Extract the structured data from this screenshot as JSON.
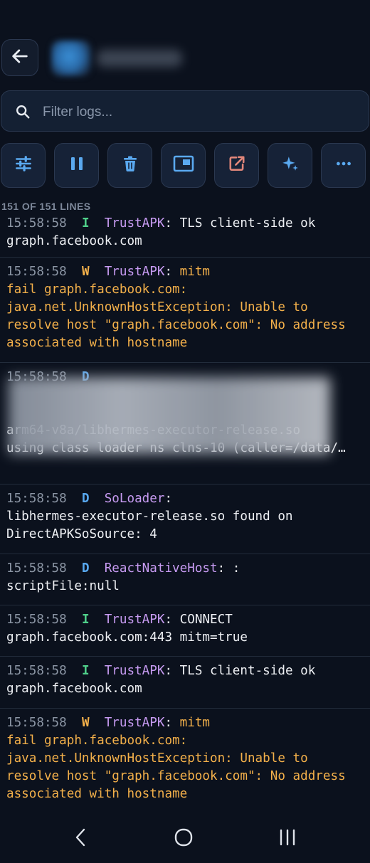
{
  "header": {
    "back_icon": "arrow-left-icon"
  },
  "search": {
    "placeholder": "Filter logs..."
  },
  "toolbar": [
    {
      "name": "filter-settings-button",
      "icon": "sliders-icon",
      "color": "#5aa9f0"
    },
    {
      "name": "pause-button",
      "icon": "pause-icon",
      "color": "#5aa9f0"
    },
    {
      "name": "clear-button",
      "icon": "trash-icon",
      "color": "#5aa9f0"
    },
    {
      "name": "pip-button",
      "icon": "picture-in-picture-icon",
      "color": "#5aa9f0"
    },
    {
      "name": "open-external-button",
      "icon": "open-external-icon",
      "color": "#e0867a"
    },
    {
      "name": "ai-button",
      "icon": "sparkles-icon",
      "color": "#5aa9f0"
    },
    {
      "name": "more-button",
      "icon": "more-horizontal-icon",
      "color": "#5aa9f0"
    }
  ],
  "line_count": "151 OF 151 LINES",
  "logs": [
    {
      "time": "15:58:58",
      "level": "I",
      "tag": "TrustAPK",
      "sep": ":",
      "lines": [
        "TLS client-side ok",
        "graph.facebook.com"
      ],
      "warn": false
    },
    {
      "time": "15:58:58",
      "level": "W",
      "tag": "TrustAPK",
      "sep": ":",
      "lines": [
        "mitm",
        "fail graph.facebook.com:",
        "java.net.UnknownHostException: Unable to",
        "resolve host \"graph.facebook.com\": No address",
        "associated with hostname"
      ],
      "warn": true
    },
    {
      "time": "15:58:58",
      "level": "D",
      "tag": "",
      "sep": "",
      "lines": [
        "",
        "",
        "",
        "arm64-v8a/libhermes-executor-release.so",
        "using class loader ns clns-10 (caller=/data/…"
      ],
      "warn": false
    },
    {
      "time": "15:58:58",
      "level": "D",
      "tag": "SoLoader",
      "sep": ":",
      "lines": [
        "",
        "libhermes-executor-release.so found on",
        "DirectAPKSoSource: 4"
      ],
      "warn": false
    },
    {
      "time": "15:58:58",
      "level": "D",
      "tag": "ReactNativeHost",
      "sep": ":",
      "lines": [
        ":",
        "scriptFile:null"
      ],
      "warn": false
    },
    {
      "time": "15:58:58",
      "level": "I",
      "tag": "TrustAPK",
      "sep": ":",
      "lines": [
        "CONNECT",
        "graph.facebook.com:443 mitm=true"
      ],
      "warn": false
    },
    {
      "time": "15:58:58",
      "level": "I",
      "tag": "TrustAPK",
      "sep": ":",
      "lines": [
        "TLS client-side ok",
        "graph.facebook.com"
      ],
      "warn": false
    },
    {
      "time": "15:58:58",
      "level": "W",
      "tag": "TrustAPK",
      "sep": ":",
      "lines": [
        "mitm",
        "fail graph.facebook.com:",
        "java.net.UnknownHostException: Unable to",
        "resolve host \"graph.facebook.com\": No address",
        "associated with hostname"
      ],
      "warn": true
    }
  ],
  "navbar": {
    "back_icon": "nav-back-icon",
    "home_icon": "nav-home-icon",
    "recents_icon": "nav-recents-icon"
  }
}
